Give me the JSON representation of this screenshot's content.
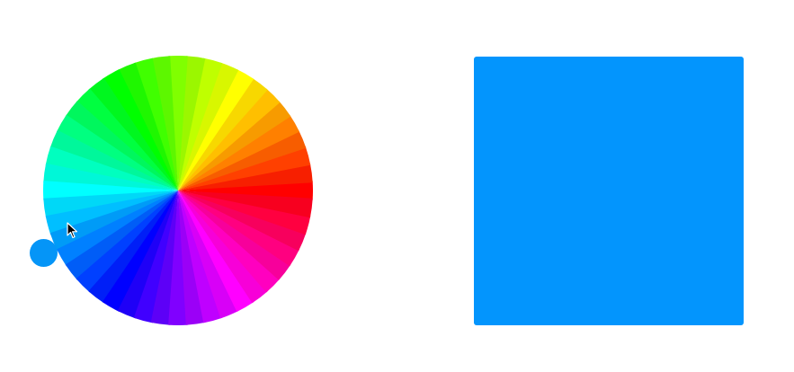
{
  "wheel": {
    "segments": 48,
    "label_icon": "color-wheel-icon"
  },
  "selector": {
    "color": "#0595f7",
    "icon": "color-selector-knob-icon"
  },
  "preview": {
    "color": "#0395fd"
  },
  "cursor": {
    "icon": "mouse-pointer-icon"
  }
}
